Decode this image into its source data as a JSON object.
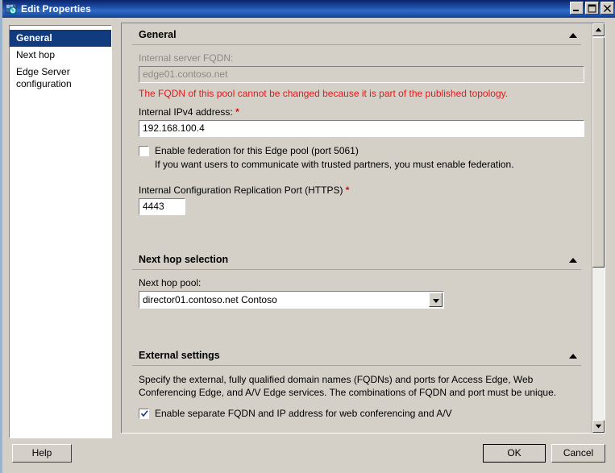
{
  "window": {
    "title": "Edit Properties",
    "icon": "server-properties-icon",
    "minimize_label": "Minimize",
    "maximize_label": "Maximize",
    "close_label": "Close",
    "titlebar_color": "#1c4ba5"
  },
  "sidebar": {
    "items": [
      {
        "label": "General",
        "selected": true
      },
      {
        "label": "Next hop",
        "selected": false
      },
      {
        "label": "Edge Server",
        "selected": false
      },
      {
        "label": "configuration",
        "selected": false
      }
    ]
  },
  "sections": {
    "general": {
      "title": "General",
      "collapse_icon": "chevron-up-icon",
      "fqdn_label": "Internal server FQDN:",
      "fqdn_value": "edge01.contoso.net",
      "error_text": "The FQDN of this pool cannot be changed because it is part of the published topology.",
      "ipv4_label": "Internal IPv4 address:",
      "ipv4_required": "*",
      "ipv4_value": "192.168.100.4",
      "federation_checkbox_label": "Enable federation for this Edge pool (port 5061)",
      "federation_checked": false,
      "federation_hint": "If you want users to communicate with trusted partners, you must enable federation.",
      "repl_port_label": "Internal Configuration Replication Port (HTTPS)",
      "repl_port_required": "*",
      "repl_port_value": "4443"
    },
    "next_hop": {
      "title": "Next hop selection",
      "collapse_icon": "chevron-up-icon",
      "pool_label": "Next hop pool:",
      "pool_value": "director01.contoso.net   Contoso",
      "dropdown_icon": "chevron-down-icon"
    },
    "external": {
      "title": "External settings",
      "collapse_icon": "chevron-up-icon",
      "description": "Specify the external, fully qualified domain names (FQDNs) and ports for Access Edge, Web Conferencing Edge, and A/V Edge services. The combinations of FQDN and port must be unique.",
      "separate_fqdn_label": "Enable separate FQDN and IP address for web conferencing and A/V",
      "separate_fqdn_checked": true
    }
  },
  "scrollbar": {
    "up_icon": "triangle-up-icon",
    "down_icon": "triangle-down-icon",
    "thumb": "scroll-thumb"
  },
  "footer": {
    "help_label": "Help",
    "ok_label": "OK",
    "cancel_label": "Cancel"
  },
  "colors": {
    "dialog_bg": "#d4d0c8",
    "selection_blue": "#113a7f",
    "error_red": "#e01b1b",
    "required_red": "#d01010"
  }
}
